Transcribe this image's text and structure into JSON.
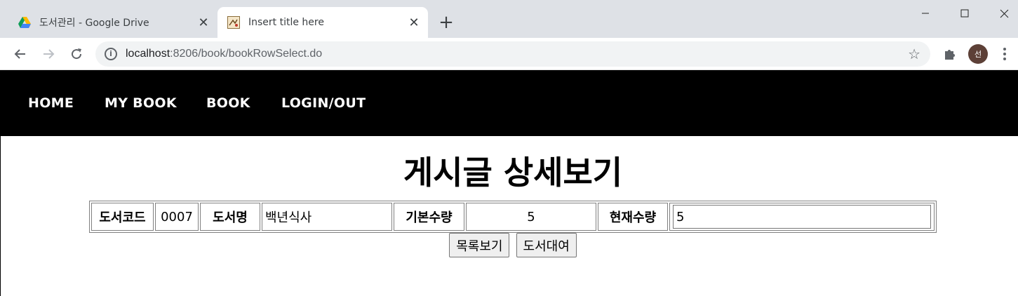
{
  "browser": {
    "tabs": [
      {
        "title": "도서관리 - Google Drive",
        "icon": "google-drive-icon",
        "active": false
      },
      {
        "title": "Insert title here",
        "icon": "page-favicon-icon",
        "active": true
      }
    ],
    "address": {
      "host": "localhost",
      "path": ":8206/book/bookRowSelect.do"
    },
    "profile_initial": "선"
  },
  "nav": {
    "items": [
      "HOME",
      "MY BOOK",
      "BOOK",
      "LOGIN/OUT"
    ]
  },
  "page": {
    "title": "게시글 상세보기"
  },
  "detail": {
    "code_label": "도서코드",
    "code_value": "0007",
    "name_label": "도서명",
    "name_value": "백년식사",
    "base_qty_label": "기본수량",
    "base_qty_value": "5",
    "current_qty_label": "현재수량",
    "current_qty_value": "5"
  },
  "buttons": {
    "list_label": "목록보기",
    "rent_label": "도서대여"
  }
}
